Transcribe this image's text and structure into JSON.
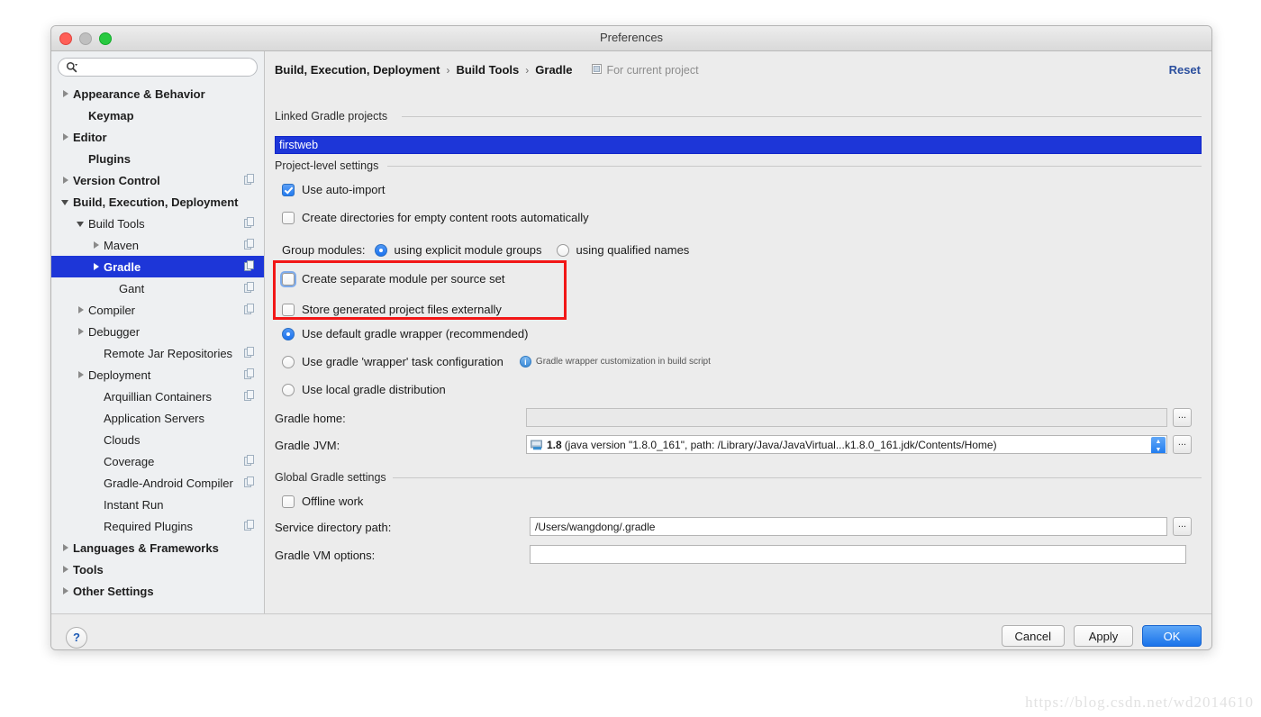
{
  "window": {
    "title": "Preferences"
  },
  "search": {
    "value": "",
    "placeholder": ""
  },
  "sidebar": {
    "items": [
      {
        "label": "Appearance & Behavior",
        "indent": 0,
        "arrow": "right",
        "bold": true,
        "copy": false,
        "selected": false
      },
      {
        "label": "Keymap",
        "indent": 1,
        "arrow": "none",
        "bold": true,
        "copy": false,
        "selected": false
      },
      {
        "label": "Editor",
        "indent": 0,
        "arrow": "right",
        "bold": true,
        "copy": false,
        "selected": false
      },
      {
        "label": "Plugins",
        "indent": 1,
        "arrow": "none",
        "bold": true,
        "copy": false,
        "selected": false
      },
      {
        "label": "Version Control",
        "indent": 0,
        "arrow": "right",
        "bold": true,
        "copy": true,
        "selected": false
      },
      {
        "label": "Build, Execution, Deployment",
        "indent": 0,
        "arrow": "down",
        "bold": true,
        "copy": false,
        "selected": false
      },
      {
        "label": "Build Tools",
        "indent": 1,
        "arrow": "down",
        "bold": false,
        "copy": true,
        "selected": false
      },
      {
        "label": "Maven",
        "indent": 2,
        "arrow": "right",
        "bold": false,
        "copy": true,
        "selected": false
      },
      {
        "label": "Gradle",
        "indent": 2,
        "arrow": "right",
        "bold": false,
        "copy": true,
        "selected": true
      },
      {
        "label": "Gant",
        "indent": 3,
        "arrow": "none",
        "bold": false,
        "copy": true,
        "selected": false
      },
      {
        "label": "Compiler",
        "indent": 1,
        "arrow": "right",
        "bold": false,
        "copy": true,
        "selected": false
      },
      {
        "label": "Debugger",
        "indent": 1,
        "arrow": "right",
        "bold": false,
        "copy": false,
        "selected": false
      },
      {
        "label": "Remote Jar Repositories",
        "indent": 2,
        "arrow": "none",
        "bold": false,
        "copy": true,
        "selected": false
      },
      {
        "label": "Deployment",
        "indent": 1,
        "arrow": "right",
        "bold": false,
        "copy": true,
        "selected": false
      },
      {
        "label": "Arquillian Containers",
        "indent": 2,
        "arrow": "none",
        "bold": false,
        "copy": true,
        "selected": false
      },
      {
        "label": "Application Servers",
        "indent": 2,
        "arrow": "none",
        "bold": false,
        "copy": false,
        "selected": false
      },
      {
        "label": "Clouds",
        "indent": 2,
        "arrow": "none",
        "bold": false,
        "copy": false,
        "selected": false
      },
      {
        "label": "Coverage",
        "indent": 2,
        "arrow": "none",
        "bold": false,
        "copy": true,
        "selected": false
      },
      {
        "label": "Gradle-Android Compiler",
        "indent": 2,
        "arrow": "none",
        "bold": false,
        "copy": true,
        "selected": false
      },
      {
        "label": "Instant Run",
        "indent": 2,
        "arrow": "none",
        "bold": false,
        "copy": false,
        "selected": false
      },
      {
        "label": "Required Plugins",
        "indent": 2,
        "arrow": "none",
        "bold": false,
        "copy": true,
        "selected": false
      },
      {
        "label": "Languages & Frameworks",
        "indent": 0,
        "arrow": "right",
        "bold": true,
        "copy": false,
        "selected": false
      },
      {
        "label": "Tools",
        "indent": 0,
        "arrow": "right",
        "bold": true,
        "copy": false,
        "selected": false
      },
      {
        "label": "Other Settings",
        "indent": 0,
        "arrow": "right",
        "bold": true,
        "copy": false,
        "selected": false
      }
    ]
  },
  "breadcrumb": {
    "segments": [
      "Build, Execution, Deployment",
      "Build Tools",
      "Gradle"
    ],
    "separator": "›",
    "scope_label": "For current project"
  },
  "reset_label": "Reset",
  "sections": {
    "linked_projects": "Linked Gradle projects",
    "project_level": "Project-level settings",
    "global_settings": "Global Gradle settings"
  },
  "linked_projects": {
    "selected_project": "firstweb"
  },
  "checkboxes": {
    "use_auto_import": {
      "label": "Use auto-import",
      "checked": true
    },
    "create_dirs": {
      "label": "Create directories for empty content roots automatically",
      "checked": false
    },
    "create_separate_module": {
      "label": "Create separate module per source set",
      "checked": false,
      "focused": true
    },
    "store_generated": {
      "label": "Store generated project files externally",
      "checked": false
    },
    "offline_work": {
      "label": "Offline work",
      "checked": false
    }
  },
  "group_modules": {
    "label": "Group modules:",
    "options": [
      {
        "label": "using explicit module groups",
        "selected": true
      },
      {
        "label": "using qualified names",
        "selected": false
      }
    ]
  },
  "distribution": {
    "options": [
      {
        "label": "Use default gradle wrapper (recommended)",
        "selected": true
      },
      {
        "label": "Use gradle 'wrapper' task configuration",
        "selected": false
      },
      {
        "label": "Use local gradle distribution",
        "selected": false
      }
    ],
    "wrapper_hint": "Gradle wrapper customization in build script"
  },
  "fields": {
    "gradle_home": {
      "label": "Gradle home:",
      "value": "",
      "browse": "..."
    },
    "gradle_jvm": {
      "label": "Gradle JVM:",
      "version": "1.8",
      "detail": "(java version \"1.8.0_161\", path: /Library/Java/JavaVirtual...k1.8.0_161.jdk/Contents/Home)",
      "browse": "..."
    },
    "service_dir": {
      "label": "Service directory path:",
      "value": "/Users/wangdong/.gradle",
      "browse": "..."
    },
    "vm_options": {
      "label": "Gradle VM options:",
      "value": "",
      "placeholder": ""
    }
  },
  "footer": {
    "help": "?",
    "cancel": "Cancel",
    "apply": "Apply",
    "ok": "OK"
  },
  "watermark": "https://blog.csdn.net/wd2014610",
  "colors": {
    "accent_blue": "#1d36d8",
    "highlight_red": "#f21717",
    "primary_button": "#1a73ea",
    "link_blue": "#2b4f9e"
  }
}
